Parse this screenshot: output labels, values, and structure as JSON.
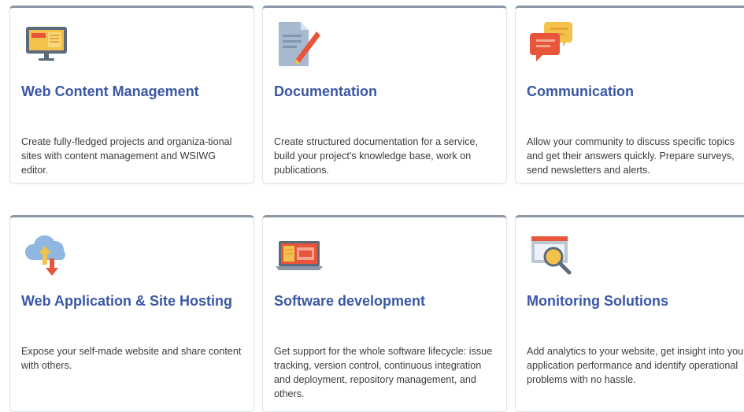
{
  "colors": {
    "title": "#3a57a4",
    "text": "#3c3c3c",
    "card_top_border": "#8c98a6",
    "card_border": "#e2e5e9"
  },
  "cards": [
    {
      "icon": "monitor-icon",
      "title": "Web Content Management",
      "description": "Create fully-fledged projects and organiza-tional sites with content management and WSIWG editor."
    },
    {
      "icon": "document-pen-icon",
      "title": "Documentation",
      "description": "Create structured documentation for a service, build your project's knowledge base, work on publications."
    },
    {
      "icon": "chat-bubbles-icon",
      "title": "Communication",
      "description": "Allow your community to discuss specific topics and get their answers quickly. Prepare surveys, send newsletters and alerts."
    },
    {
      "icon": "cloud-upload-download-icon",
      "title": "Web Application & Site Hosting",
      "description": "Expose your self-made website and share content with others."
    },
    {
      "icon": "laptop-code-icon",
      "title": "Software development",
      "description": "Get support for the whole software lifecycle: issue tracking, version control, continuous integration and deployment, repository management, and others."
    },
    {
      "icon": "monitor-magnifier-icon",
      "title": "Monitoring Solutions",
      "description": "Add analytics to your website, get insight into your application performance and identify operational problems with no hassle."
    }
  ]
}
